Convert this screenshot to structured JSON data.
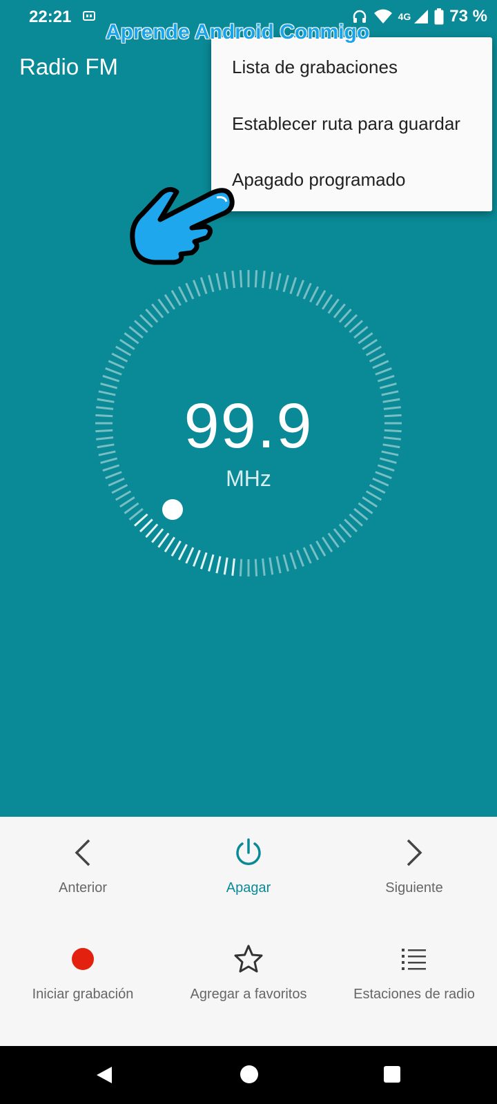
{
  "status_bar": {
    "time": "22:21",
    "network": "4G",
    "battery": "73 %"
  },
  "watermark": "Aprende Android Conmigo",
  "app": {
    "title": "Radio FM"
  },
  "menu": {
    "items": [
      {
        "label": "Lista de grabaciones"
      },
      {
        "label": "Establecer ruta para guardar"
      },
      {
        "label": "Apagado programado"
      }
    ]
  },
  "tuner": {
    "frequency": "99.9",
    "unit": "MHz"
  },
  "controls": {
    "row1": [
      {
        "label": "Anterior",
        "icon": "chevron-left-icon"
      },
      {
        "label": "Apagar",
        "icon": "power-icon"
      },
      {
        "label": "Siguiente",
        "icon": "chevron-right-icon"
      }
    ],
    "row2": [
      {
        "label": "Iniciar grabación",
        "icon": "record-icon"
      },
      {
        "label": "Agregar a favoritos",
        "icon": "star-icon"
      },
      {
        "label": "Estaciones de radio",
        "icon": "list-icon"
      }
    ]
  },
  "colors": {
    "background": "#0a8a96",
    "accent": "#0a8a96",
    "record": "#e3210f",
    "watermark": "#1aa3e8"
  }
}
